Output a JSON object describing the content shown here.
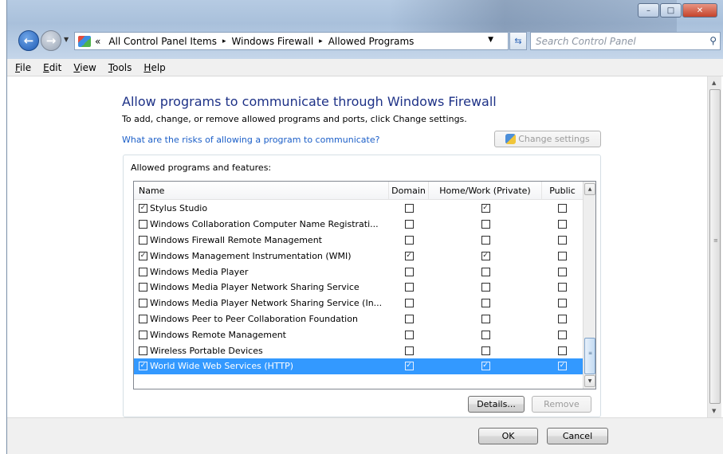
{
  "window": {
    "controls": {
      "minimize": "–",
      "maximize": "□",
      "close": "✕"
    }
  },
  "address_bar": {
    "prefix": "«",
    "crumbs": [
      "All Control Panel Items",
      "Windows Firewall",
      "Allowed Programs"
    ],
    "separator": "▸"
  },
  "search": {
    "placeholder": "Search Control Panel"
  },
  "menu": {
    "items": [
      {
        "label": "File",
        "accel": "F",
        "rest": "ile"
      },
      {
        "label": "Edit",
        "accel": "E",
        "rest": "dit"
      },
      {
        "label": "View",
        "accel": "V",
        "rest": "iew"
      },
      {
        "label": "Tools",
        "accel": "T",
        "rest": "ools"
      },
      {
        "label": "Help",
        "accel": "H",
        "rest": "elp"
      }
    ]
  },
  "main": {
    "title": "Allow programs to communicate through Windows Firewall",
    "subtitle": "To add, change, or remove allowed programs and ports, click Change settings.",
    "risk_link": "What are the risks of allowing a program to communicate?",
    "change_settings_label": "Change settings",
    "group_label": "Allowed programs and features:",
    "columns": {
      "name": "Name",
      "domain": "Domain",
      "home": "Home/Work (Private)",
      "public": "Public"
    },
    "rows": [
      {
        "name": "Stylus Studio",
        "enabled": true,
        "domain": false,
        "home": true,
        "public": false
      },
      {
        "name": "Windows Collaboration Computer Name Registrati...",
        "enabled": false,
        "domain": false,
        "home": false,
        "public": false
      },
      {
        "name": "Windows Firewall Remote Management",
        "enabled": false,
        "domain": false,
        "home": false,
        "public": false
      },
      {
        "name": "Windows Management Instrumentation (WMI)",
        "enabled": true,
        "domain": true,
        "home": true,
        "public": false
      },
      {
        "name": "Windows Media Player",
        "enabled": false,
        "domain": false,
        "home": false,
        "public": false
      },
      {
        "name": "Windows Media Player Network Sharing Service",
        "enabled": false,
        "domain": false,
        "home": false,
        "public": false
      },
      {
        "name": "Windows Media Player Network Sharing Service (In...",
        "enabled": false,
        "domain": false,
        "home": false,
        "public": false
      },
      {
        "name": "Windows Peer to Peer Collaboration Foundation",
        "enabled": false,
        "domain": false,
        "home": false,
        "public": false
      },
      {
        "name": "Windows Remote Management",
        "enabled": false,
        "domain": false,
        "home": false,
        "public": false
      },
      {
        "name": "Wireless Portable Devices",
        "enabled": false,
        "domain": false,
        "home": false,
        "public": false
      },
      {
        "name": "World Wide Web Services (HTTP)",
        "enabled": true,
        "domain": true,
        "home": true,
        "public": true,
        "selected": true
      }
    ],
    "details_label": "Details...",
    "remove_label": "Remove"
  },
  "footer": {
    "ok_label": "OK",
    "cancel_label": "Cancel"
  },
  "colors": {
    "title": "#1e3287",
    "link": "#1c5fc8",
    "selection": "#3399ff"
  }
}
